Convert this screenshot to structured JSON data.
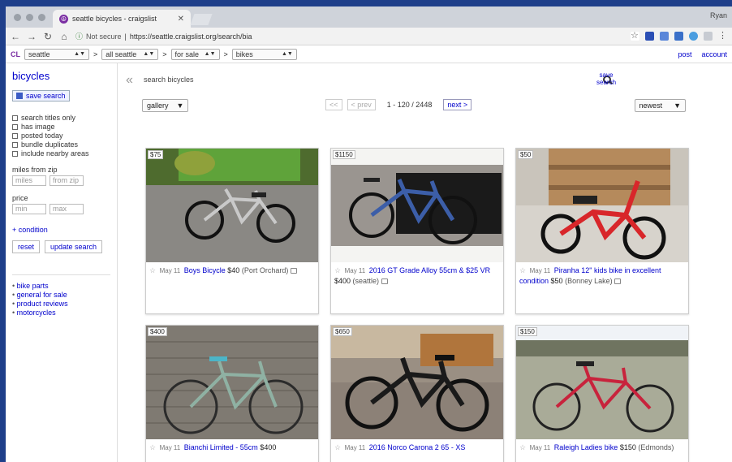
{
  "browser": {
    "tab_title": "seattle bicycles - craigslist",
    "tab_favicon": "peace-icon",
    "profile": "Ryan",
    "address_security": "Not secure",
    "address_url": "https://seattle.craigslist.org/search/bia"
  },
  "header": {
    "logo": "CL",
    "city": "seattle",
    "area": "all seattle",
    "category": "for sale",
    "subcategory": "bikes",
    "post_label": "post",
    "account_label": "account"
  },
  "sidebar": {
    "title": "bicycles",
    "save_search": "save search",
    "checks": [
      "search titles only",
      "has image",
      "posted today",
      "bundle duplicates",
      "include nearby areas"
    ],
    "miles_label": "miles from zip",
    "miles_placeholder": "miles",
    "zip_placeholder": "from zip",
    "price_label": "price",
    "min_placeholder": "min",
    "max_placeholder": "max",
    "condition_label": "+ condition",
    "reset_label": "reset",
    "update_label": "update search",
    "links": [
      "bike parts",
      "general for sale",
      "product reviews",
      "motorcycles"
    ]
  },
  "main": {
    "search_placeholder": "search bicycles",
    "save_search_line1": "save",
    "save_search_line2": "search",
    "view": "gallery",
    "prev_first": "<<",
    "prev": "< prev",
    "range": "1 - 120 / 2448",
    "next": "next >",
    "sort": "newest"
  },
  "listings": [
    {
      "price": "$75",
      "date": "May 11",
      "title": "Boys Bicycle",
      "price2": "$40",
      "loc": "(Port Orchard)"
    },
    {
      "price": "$1150",
      "date": "May 11",
      "title": "2016 GT Grade Alloy 55cm & $25 VR",
      "price2": "$400",
      "loc": "(seattle)"
    },
    {
      "price": "$50",
      "date": "May 11",
      "title": "Piranha 12\" kids bike in excellent condition",
      "price2": "$50",
      "loc": "(Bonney Lake)"
    },
    {
      "price": "$400",
      "date": "May 11",
      "title": "Bianchi Limited - 55cm",
      "price2": "$400",
      "loc": ""
    },
    {
      "price": "$650",
      "date": "May 11",
      "title": "2016 Norco Carona 2 65 - XS",
      "price2": "",
      "loc": ""
    },
    {
      "price": "$150",
      "date": "May 11",
      "title": "Raleigh Ladies bike",
      "price2": "$150",
      "loc": "(Edmonds)"
    }
  ]
}
